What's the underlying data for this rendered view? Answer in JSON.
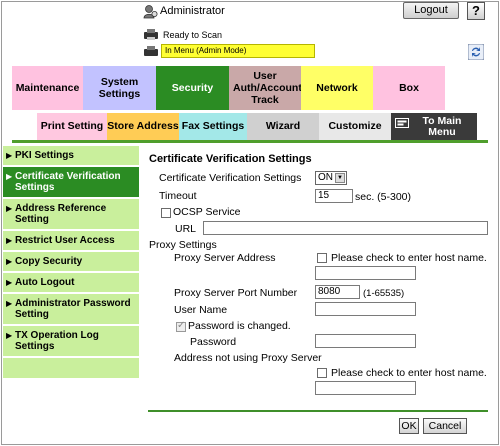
{
  "header": {
    "user_label": "Administrator",
    "logout_label": "Logout",
    "help_label": "?",
    "status_text": "Ready to Scan",
    "mode_text": "In Menu (Admin Mode)"
  },
  "tabs_main": [
    {
      "label": "Maintenance",
      "color": "#ffb3d9",
      "active": false
    },
    {
      "label": "System Settings",
      "color": "#b3b3ff",
      "active": false
    },
    {
      "label": "Security",
      "color": "#2b8c23",
      "active": true
    },
    {
      "label": "User Auth/Account Track",
      "color": "#c8a6a6",
      "active": false
    },
    {
      "label": "Network",
      "color": "#ffff66",
      "active": false
    },
    {
      "label": "Box",
      "color": "#ffb3d9",
      "active": false
    }
  ],
  "tabs_sub": [
    {
      "label": "Print Setting",
      "color": "#ffc2dc"
    },
    {
      "label": "Store Address",
      "color": "#ffcc55"
    },
    {
      "label": "Fax Settings",
      "color": "#99e6e6"
    },
    {
      "label": "Wizard",
      "color": "#cfcfcf"
    },
    {
      "label": "Customize",
      "color": "#e6e6e6"
    },
    {
      "label": "To Main Menu",
      "color": "#3b3b3b"
    }
  ],
  "sidebar": {
    "items": [
      {
        "label": "PKI Settings",
        "active": false
      },
      {
        "label": "Certificate Verification Settings",
        "active": true
      },
      {
        "label": "Address Reference Setting",
        "active": false
      },
      {
        "label": "Restrict User Access",
        "active": false
      },
      {
        "label": "Copy Security",
        "active": false
      },
      {
        "label": "Auto Logout",
        "active": false
      },
      {
        "label": "Administrator Password Setting",
        "active": false
      },
      {
        "label": "TX Operation Log Settings",
        "active": false
      }
    ]
  },
  "form": {
    "title": "Certificate Verification Settings",
    "cvs_label": "Certificate Verification Settings",
    "cvs_value": "ON",
    "timeout_label": "Timeout",
    "timeout_value": "15",
    "timeout_unit": "sec. (5-300)",
    "ocsp_label": "OCSP Service",
    "ocsp_checked": false,
    "url_label": "URL",
    "url_value": "",
    "proxy_settings_label": "Proxy Settings",
    "proxy_address_label": "Proxy Server Address",
    "host_check_label": "Please check to enter host name.",
    "proxy_address_value": "",
    "proxy_port_label": "Proxy Server Port Number",
    "proxy_port_value": "8080",
    "proxy_port_range": "(1-65535)",
    "user_name_label": "User Name",
    "user_name_value": "",
    "pw_changed_label": "Password is changed.",
    "pw_changed_checked": true,
    "password_label": "Password",
    "password_value": "",
    "no_proxy_label": "Address not using Proxy Server",
    "no_proxy_host_check_label": "Please check to enter host name.",
    "no_proxy_value": "",
    "ok_label": "OK",
    "cancel_label": "Cancel"
  }
}
